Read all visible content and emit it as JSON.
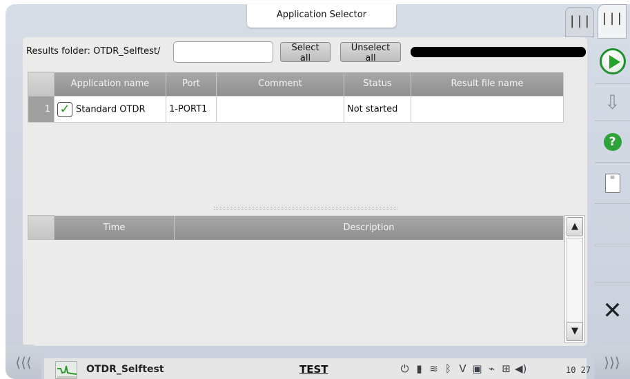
{
  "window": {
    "title": "Application Selector"
  },
  "top_tabs": [
    {
      "icon": "vertical-bars-icon",
      "glyph": "|||"
    },
    {
      "icon": "vertical-bars-icon",
      "glyph": "|||"
    }
  ],
  "toolbar": {
    "folder_label": "Results folder: OTDR_Selftest/",
    "folder_value": "",
    "select_all": "Select all",
    "unselect_all": "Unselect all"
  },
  "applications": {
    "columns": [
      "",
      "Application name",
      "Port",
      "Comment",
      "Status",
      "Result file name"
    ],
    "rows": [
      {
        "index": "1",
        "checked": true,
        "name": "Standard OTDR",
        "port": "1-PORT1",
        "comment": "",
        "status": "Not started",
        "result_file": ""
      }
    ]
  },
  "log": {
    "columns": [
      "",
      "Time",
      "Description"
    ],
    "rows": []
  },
  "scrollbar": {
    "up": "▲",
    "down": "▼"
  },
  "right_rail": [
    {
      "name": "run-icon"
    },
    {
      "name": "save-icon",
      "glyph": "⇩"
    },
    {
      "name": "help-icon",
      "glyph": "?"
    },
    {
      "name": "report-icon",
      "glyph": "≡"
    },
    {
      "name": "close-icon",
      "glyph": "✕"
    }
  ],
  "bottom_bar": {
    "nav_left": "⟨⟨⟨",
    "nav_right": "⟩⟩⟩",
    "app_name": "OTDR_Selftest",
    "mode": "TEST",
    "clock": "10 27",
    "status_icons": [
      "power-plug-icon",
      "battery-icon",
      "wifi-icon",
      "bluetooth-icon",
      "vfl-icon",
      "remote-icon",
      "signal-icon",
      "network-icon",
      "volume-icon"
    ]
  },
  "colors": {
    "accent_green": "#23a52a",
    "progress_bar": "#000000",
    "frame": "#ccd3de"
  }
}
